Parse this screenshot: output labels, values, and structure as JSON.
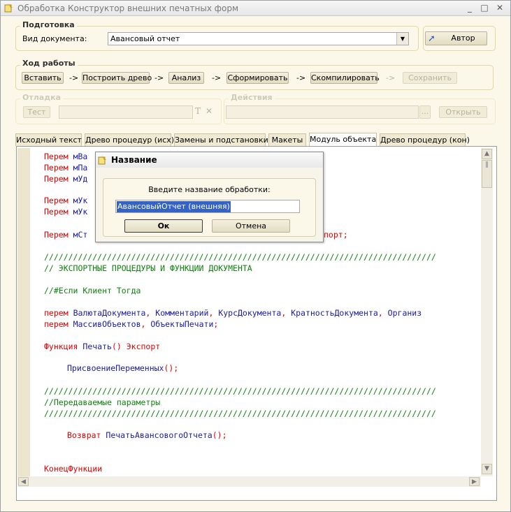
{
  "window": {
    "title": "Обработка  Конструктор внешних печатных форм"
  },
  "prep": {
    "title": "Подготовка",
    "doc_type_label": "Вид документа:",
    "doc_type_value": "Авансовый отчет",
    "author_button": "Автор"
  },
  "workflow": {
    "title": "Ход работы",
    "steps": [
      "Вставить",
      "Построить древо",
      "Анализ",
      "Сформировать",
      "Скомпилировать",
      "Сохранить"
    ],
    "arrow": "->"
  },
  "debug": {
    "title": "Отладка",
    "test_button": "Тест"
  },
  "actions": {
    "title": "Действия",
    "open_button": "Открыть",
    "browse_button": "..."
  },
  "tabs": [
    "Исходный текст",
    "Древо процедур (исх)",
    "Замены и подстановки",
    "Макеты",
    "Модуль объекта",
    "Древо процедур (кон)"
  ],
  "active_tab": "Модуль объекта",
  "code": {
    "l1_kw": "Перем",
    "l1_id": "мВа",
    "l2_kw": "Перем",
    "l2_id": "мПа",
    "l3_kw": "Перем",
    "l3_id": "мУд",
    "l4_kw": "Перем",
    "l4_id": "мУк",
    "l5_kw": "Перем",
    "l5_id": "мУк",
    "l6_kw": "Перем",
    "l6_id": "мСт",
    "l6_tail": "порт;",
    "sep1": "/////////////////////////////////////////////////////////////////////////////////",
    "comment1": "// ЭКСПОРТНЫЕ ПРОЦЕДУРЫ И ФУНКЦИИ ДОКУМЕНТА",
    "comment2": "//#Если Клиент Тогда",
    "l7_kw": "перем",
    "l7_v1": "ВалютаДокумента",
    "l7_v2": "Комментарий",
    "l7_v3": "КурсДокумента",
    "l7_v4": "КратностьДокумента",
    "l7_v5": "Организ",
    "l8_kw": "перем",
    "l8_v1": "МассивОбъектов",
    "l8_v2": "ОбъектыПечати",
    "func_kw": "Функция",
    "func_name": "Печать",
    "func_export": "Экспорт",
    "call": "ПрисвоениеПеременных",
    "sep2": "/////////////////////////////////////////////////////////////////////////////////",
    "comment3": "//Передаваемые параметры",
    "sep3": "/////////////////////////////////////////////////////////////////////////////////",
    "ret_kw": "Возврат",
    "ret_call": "ПечатьАвансовогоОтчета",
    "end_kw": "КонецФункции"
  },
  "dialog": {
    "title": "Название",
    "prompt": "Введите название обработки:",
    "value": "АвансовыйОтчет (внешняя)",
    "ok": "Ок",
    "cancel": "Отмена"
  },
  "colors": {
    "keyword": "#e00000",
    "identifier": "#1a1aa6",
    "comment": "#108010",
    "selection": "#3563c5"
  }
}
